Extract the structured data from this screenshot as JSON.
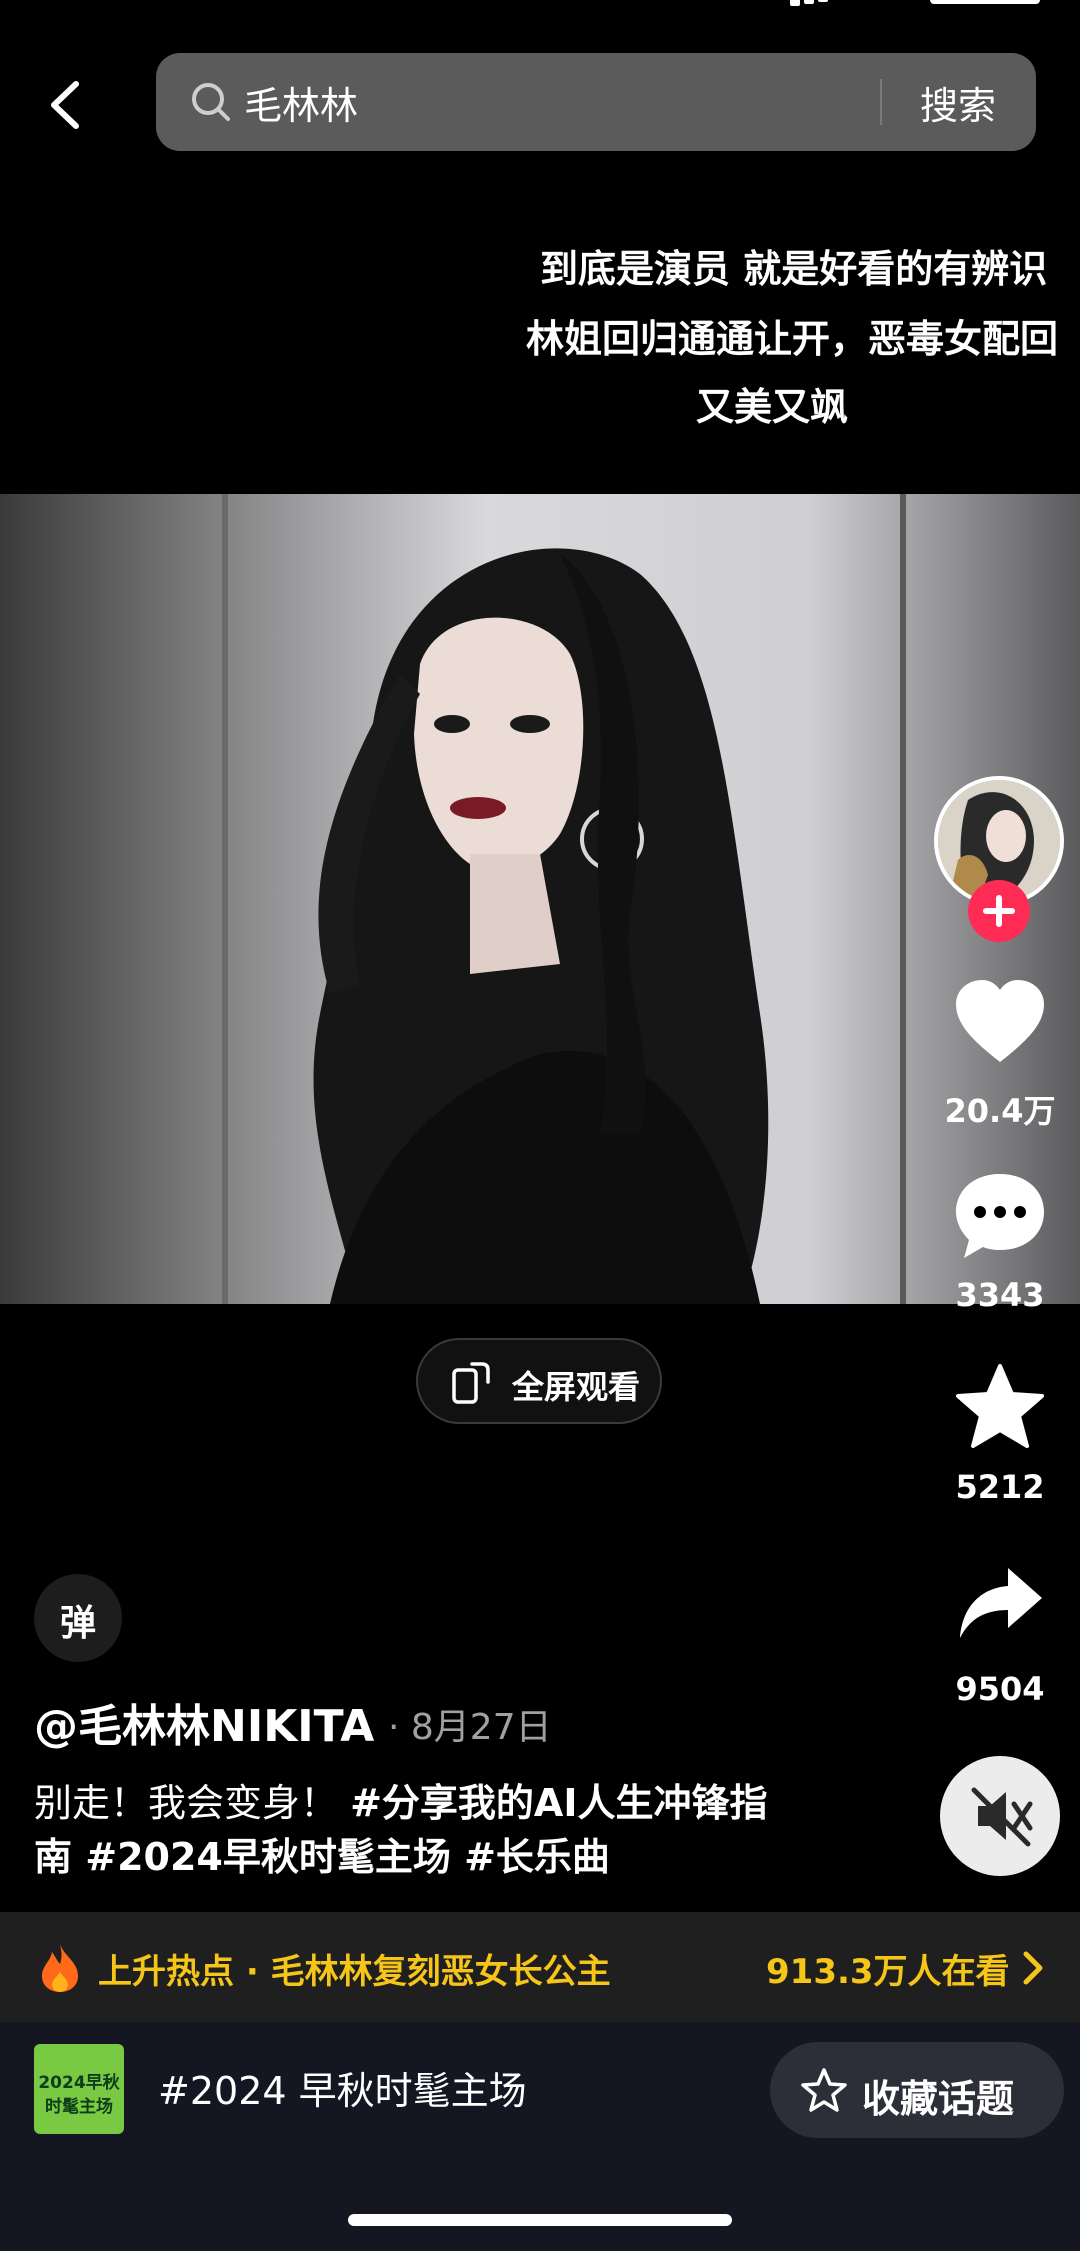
{
  "search": {
    "query": "毛林林",
    "submit_label": "搜索"
  },
  "caption": {
    "line1": "到底是演员 就是好看的有辨识",
    "line2": "林姐回归通通让开，恶毒女配回",
    "line3": "又美又飒"
  },
  "player": {
    "fullscreen_label": "全屏观看"
  },
  "rail": {
    "like_count": "20.4万",
    "comment_count": "3343",
    "collect_count": "5212",
    "share_count": "9504"
  },
  "danmu_label": "弹",
  "post": {
    "author": "@毛林林NIKITA",
    "date": "· 8月27日",
    "desc_text": "别走！我会变身！ ",
    "tag1": "#分享我的AI人生冲锋指",
    "tag1_cont": "南",
    "tag2": " #2024早秋时髦主场",
    "tag3": " #长乐曲"
  },
  "hot": {
    "text": "上升热点 · 毛林林复刻恶女长公主",
    "viewers": "913.3万人在看"
  },
  "topic": {
    "thumb_line1": "2024早秋",
    "thumb_line2": "时髦主场",
    "title": "#2024 早秋时髦主场",
    "fav_label": "收藏话题"
  },
  "colors": {
    "accent_red": "#fe2c55",
    "hot_yellow": "#f5c518"
  },
  "icons": [
    "back-icon",
    "search-icon",
    "fullscreen-icon",
    "heart-icon",
    "comment-icon",
    "star-icon",
    "share-icon",
    "mute-icon",
    "fire-icon",
    "chevron-right-icon"
  ]
}
